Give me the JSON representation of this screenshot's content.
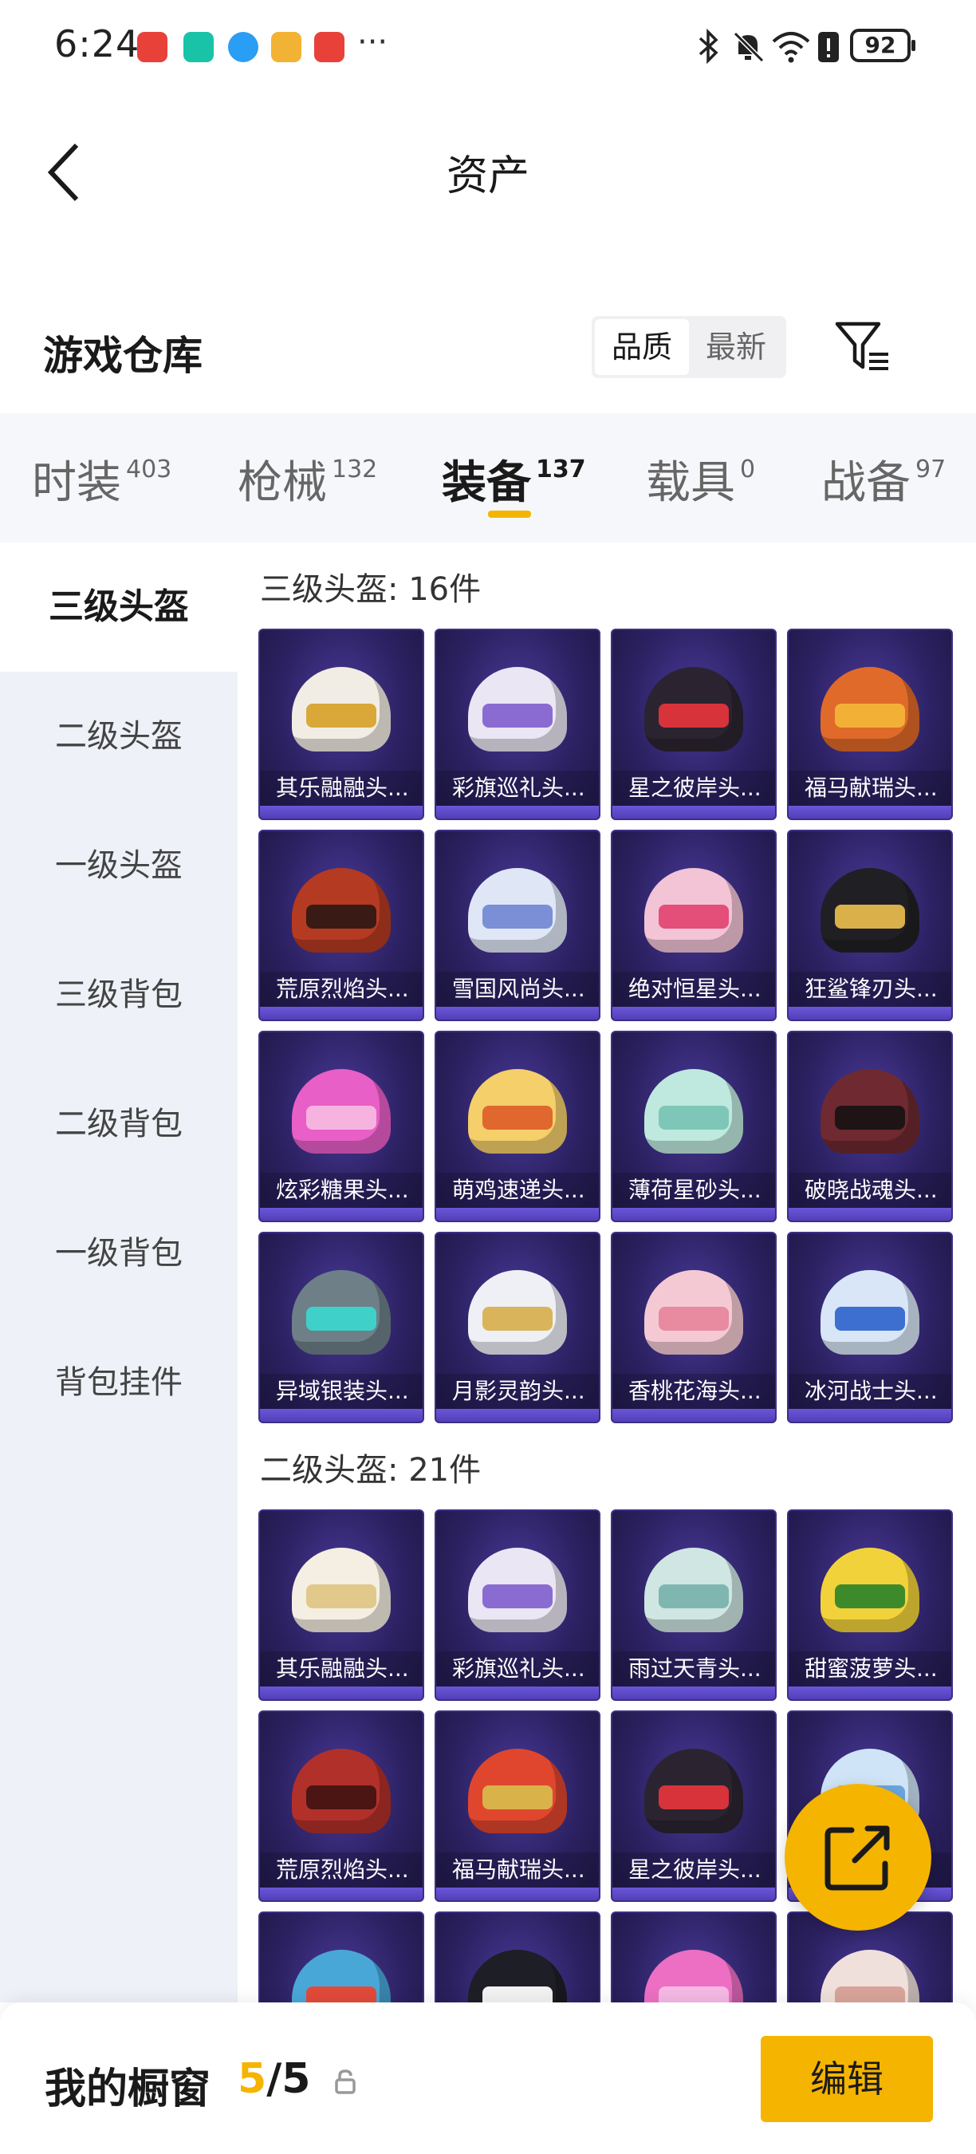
{
  "status_bar": {
    "time": "6:24",
    "more": "···",
    "battery": "92",
    "notification_icons": [
      "huawei-app-icon",
      "shield-app-icon",
      "browser-app-icon",
      "music-app-icon",
      "huawei-app-icon"
    ],
    "system_icons": [
      "bluetooth-icon",
      "mute-icon",
      "wifi-icon",
      "alert-icon"
    ]
  },
  "header": {
    "title": "资产"
  },
  "warehouse": {
    "title": "游戏仓库",
    "sort_options": [
      {
        "label": "品质",
        "active": true
      },
      {
        "label": "最新",
        "active": false
      }
    ]
  },
  "tabs": [
    {
      "label": "时装",
      "count": "403"
    },
    {
      "label": "枪械",
      "count": "132"
    },
    {
      "label": "装备",
      "count": "137",
      "active": true
    },
    {
      "label": "载具",
      "count": "0"
    },
    {
      "label": "战备",
      "count": "97"
    }
  ],
  "sidebar": [
    {
      "label": "三级头盔",
      "active": true
    },
    {
      "label": "二级头盔"
    },
    {
      "label": "一级头盔"
    },
    {
      "label": "三级背包"
    },
    {
      "label": "二级背包"
    },
    {
      "label": "一级背包"
    },
    {
      "label": "背包挂件"
    }
  ],
  "sections": [
    {
      "title": "三级头盔: 16件",
      "items": [
        "其乐融融头...",
        "彩旗巡礼头...",
        "星之彼岸头...",
        "福马献瑞头...",
        "荒原烈焰头...",
        "雪国风尚头...",
        "绝对恒星头...",
        "狂鲨锋刃头...",
        "炫彩糖果头...",
        "萌鸡速递头...",
        "薄荷星砂头...",
        "破晓战魂头...",
        "异域银装头...",
        "月影灵韵头...",
        "香桃花海头...",
        "冰河战士头..."
      ]
    },
    {
      "title": "二级头盔: 21件",
      "items": [
        "其乐融融头...",
        "彩旗巡礼头...",
        "雨过天青头...",
        "甜蜜菠萝头...",
        "荒原烈焰头...",
        "福马献瑞头...",
        "星之彼岸头...",
        ""
      ]
    }
  ],
  "bottom_bar": {
    "title": "我的橱窗",
    "current": "5",
    "separator": "/",
    "total": "5",
    "edit_label": "编辑"
  }
}
